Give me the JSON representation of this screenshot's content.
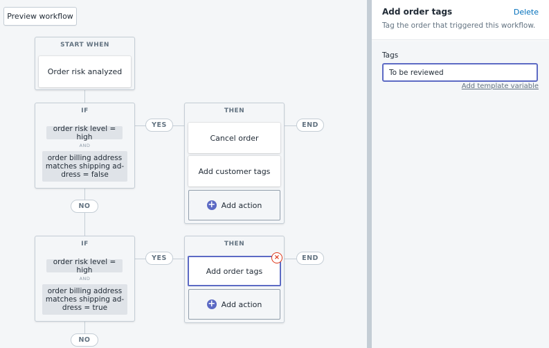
{
  "toolbar": {
    "preview_label": "Preview workflow"
  },
  "start": {
    "header": "START WHEN",
    "trigger": "Order risk analyzed"
  },
  "conditions": [
    {
      "header": "IF",
      "cond1": "order risk level =  high",
      "joiner": "AND",
      "cond2": "order billing address matches shipping ad-dress = false",
      "yes_label": "YES",
      "no_label": "NO"
    },
    {
      "header": "IF",
      "cond1": "order risk level =  high",
      "joiner": "AND",
      "cond2": "order billing address matches shipping ad-dress = true",
      "yes_label": "YES",
      "no_label": "NO"
    }
  ],
  "then_blocks": [
    {
      "header": "THEN",
      "actions": [
        "Cancel order",
        "Add customer tags"
      ],
      "add_label": "Add action",
      "end_label": "END"
    },
    {
      "header": "THEN",
      "actions": [
        "Add order tags"
      ],
      "add_label": "Add action",
      "end_label": "END"
    }
  ],
  "panel": {
    "title": "Add order tags",
    "delete_label": "Delete",
    "description": "Tag the order that triggered this workflow.",
    "tags_label": "Tags",
    "tags_value": "To be reviewed",
    "template_link": "Add template variable"
  },
  "icons": {
    "plus": "+",
    "close": "×"
  },
  "colors": {
    "accent": "#5c6ac4",
    "danger": "#de3618",
    "link": "#006fbb"
  }
}
